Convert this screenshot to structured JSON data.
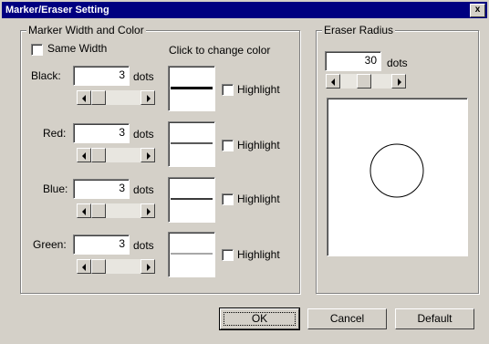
{
  "window": {
    "title": "Marker/Eraser Setting",
    "close_glyph": "x"
  },
  "marker_group": {
    "label": "Marker Width and Color",
    "same_width": {
      "label": "Same Width",
      "checked": false
    },
    "click_hint": "Click to change color",
    "units": "dots",
    "highlight_label": "Highlight",
    "rows": [
      {
        "name": "black",
        "label": "Black:",
        "value": "3",
        "color": "#000000"
      },
      {
        "name": "red",
        "label": "Red:",
        "value": "3",
        "color": "#5a5a5a"
      },
      {
        "name": "blue",
        "label": "Blue:",
        "value": "3",
        "color": "#3a3a3a"
      },
      {
        "name": "green",
        "label": "Green:",
        "value": "3",
        "color": "#a8a8a8"
      }
    ]
  },
  "eraser_group": {
    "label": "Eraser Radius",
    "value": "30",
    "units": "dots"
  },
  "buttons": {
    "ok": "OK",
    "cancel": "Cancel",
    "default": "Default"
  }
}
